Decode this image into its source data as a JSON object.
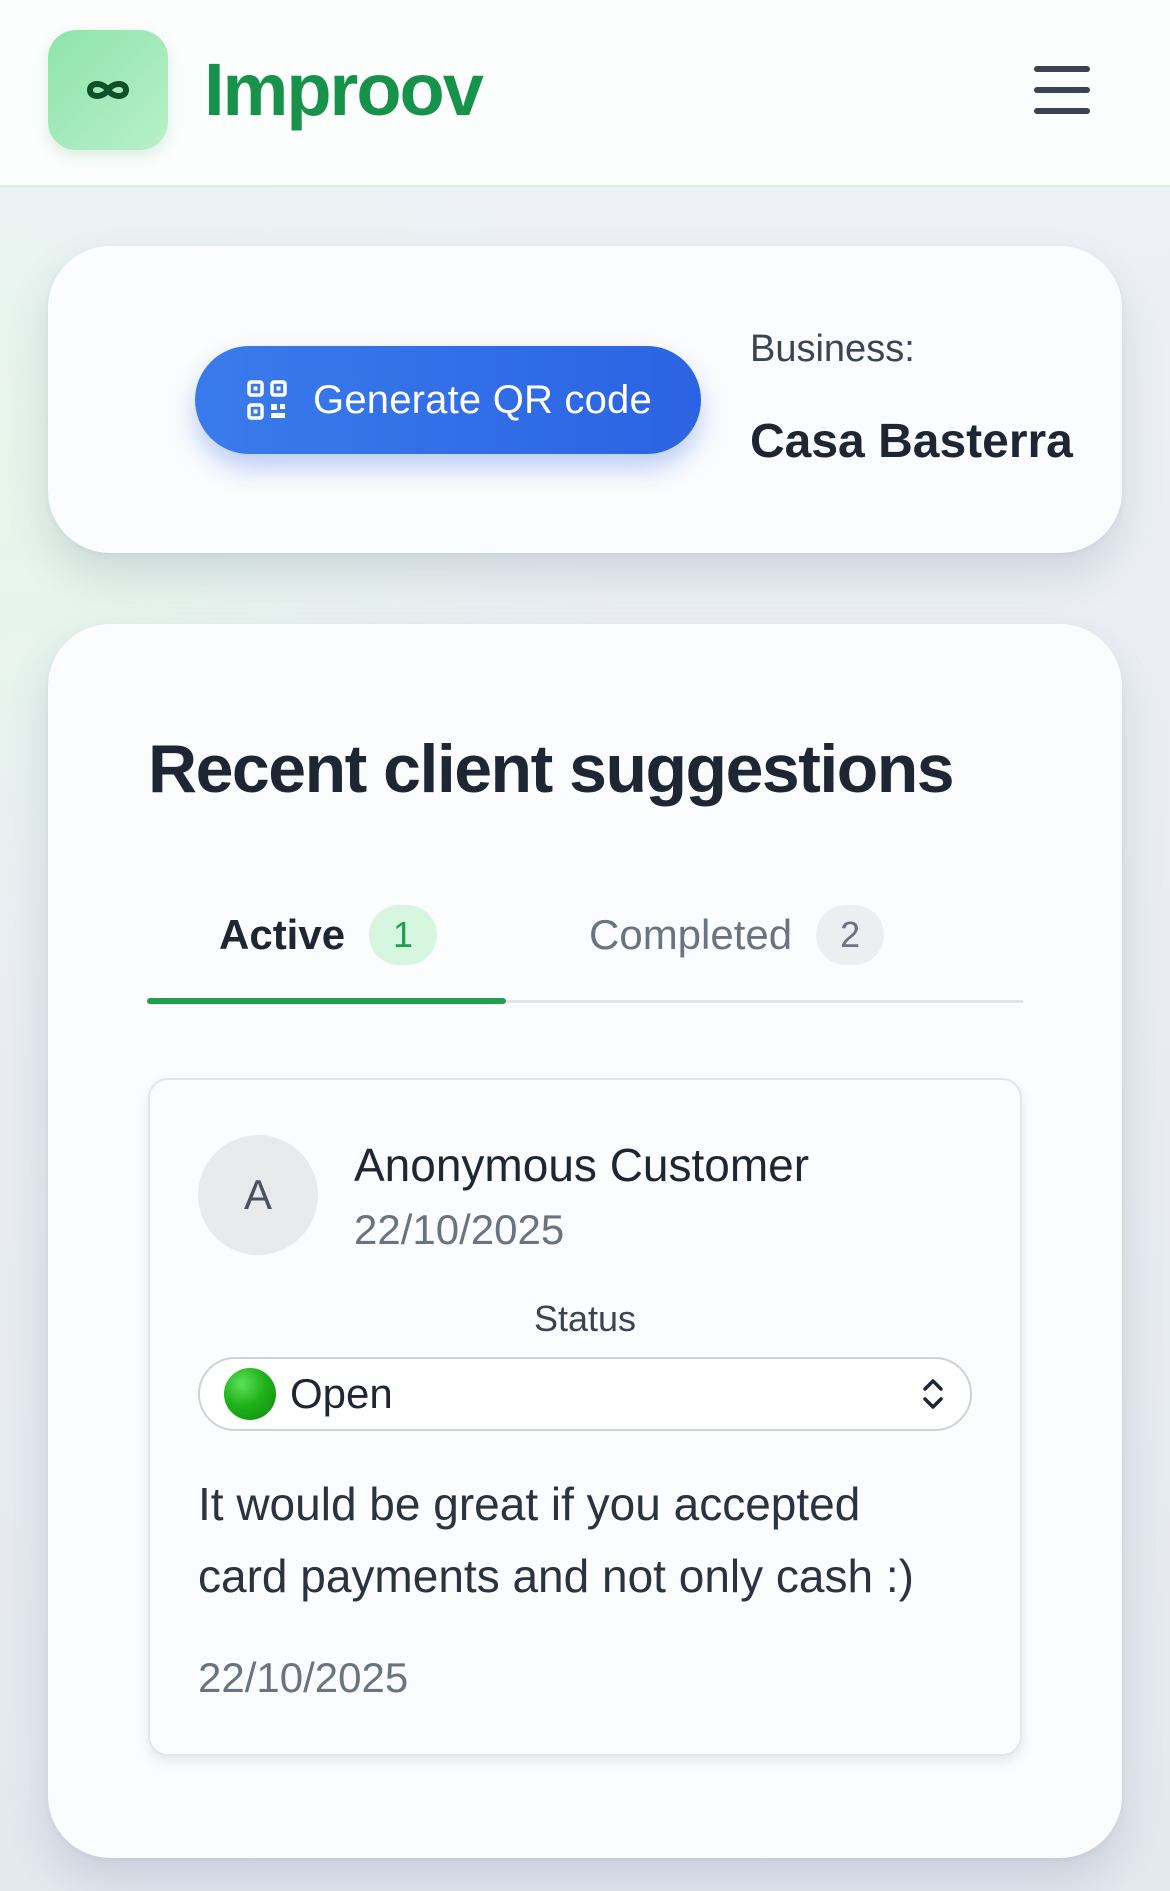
{
  "header": {
    "brand": "Improov",
    "logo_icon": "infinity-icon",
    "menu_icon": "hamburger-menu-icon",
    "brand_color": "#16924a"
  },
  "business_card": {
    "qr_button_label": "Generate QR code",
    "qr_icon": "qr-code-icon",
    "business_label": "Business:",
    "business_name": "Casa Basterra",
    "accent_color": "#2b63e3"
  },
  "suggestions_section": {
    "title": "Recent client suggestions",
    "tabs": [
      {
        "label": "Active",
        "count": "1",
        "selected": true
      },
      {
        "label": "Completed",
        "count": "2",
        "selected": false
      }
    ],
    "items": [
      {
        "avatar_initial": "A",
        "customer_name": "Anonymous Customer",
        "customer_date": "22/10/2025",
        "status_label": "Status",
        "status_value": "Open",
        "status_icon": "green-circle-icon",
        "text": "It would be great if you accepted card payments and not only cash :)",
        "date": "22/10/2025"
      }
    ]
  }
}
